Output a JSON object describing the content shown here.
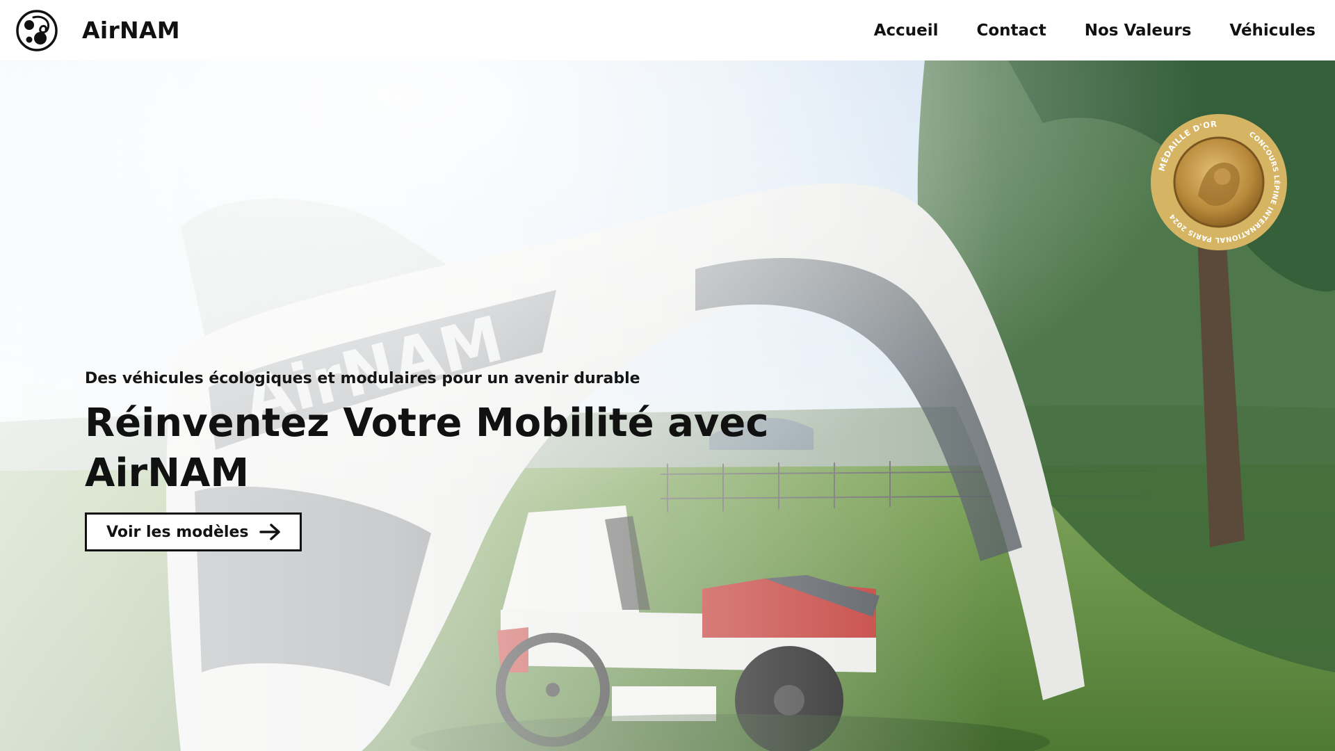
{
  "navbar": {
    "brand": {
      "name": "AirNAM",
      "logo_icon": "airnam-swirl-logo-icon"
    },
    "links": [
      {
        "label": "Accueil"
      },
      {
        "label": "Contact"
      },
      {
        "label": "Nos Valeurs"
      },
      {
        "label": "Véhicules"
      }
    ]
  },
  "hero": {
    "tagline": "Des véhicules écologiques et modulaires pour un avenir durable",
    "title": "Réinventez Votre Mobilité avec AirNAM",
    "cta": {
      "label": "Voir les modèles",
      "icon": "arrow-right-icon"
    },
    "medal": {
      "line1": "MÉDAILLE D'OR",
      "line2": "CONCOURS LÉPINE INTERNATIONAL PARIS 2024"
    },
    "background_image": {
      "subject": "Inflatable AirNAM arch over a small white and red electric vehicle on grass",
      "arch_lettering": "AirNAM"
    }
  },
  "colors": {
    "text_primary": "#111111",
    "nav_background": "#ffffff",
    "button_border": "#111111",
    "medal_gold": "#c9a24e",
    "medal_ring": "#d8b766"
  }
}
